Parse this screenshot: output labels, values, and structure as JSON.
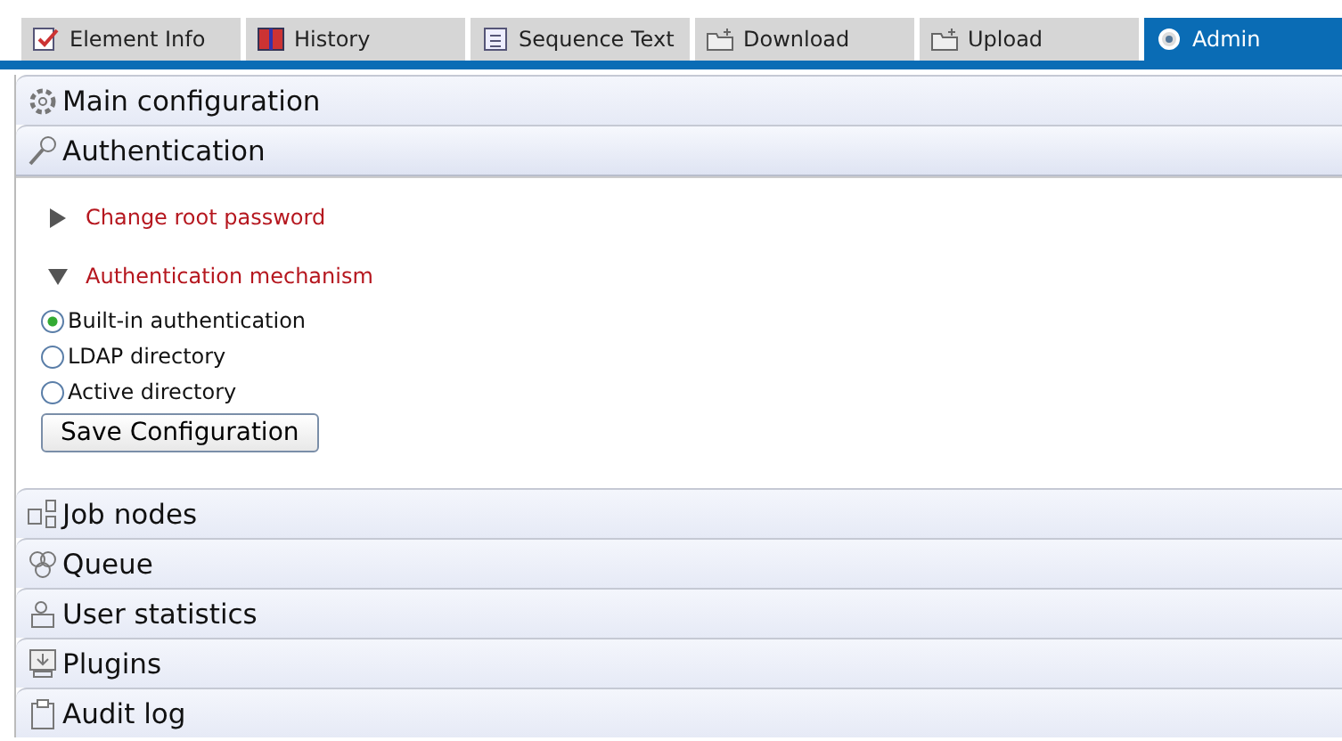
{
  "tabs": [
    {
      "label": "Element Info",
      "selected": false
    },
    {
      "label": "History",
      "selected": false
    },
    {
      "label": "Sequence Text",
      "selected": false
    },
    {
      "label": "Download",
      "selected": false
    },
    {
      "label": "Upload",
      "selected": false
    },
    {
      "label": "Admin",
      "selected": true
    }
  ],
  "sections": [
    {
      "title": "Main configuration",
      "expanded": false
    },
    {
      "title": "Authentication",
      "expanded": true,
      "subsections": [
        {
          "title": "Change root password",
          "expanded": false
        },
        {
          "title": "Authentication mechanism",
          "expanded": true,
          "options": [
            {
              "label": "Built-in authentication",
              "selected": true
            },
            {
              "label": "LDAP directory",
              "selected": false
            },
            {
              "label": "Active directory",
              "selected": false
            }
          ],
          "button": "Save Configuration"
        }
      ]
    },
    {
      "title": "Job nodes",
      "expanded": false
    },
    {
      "title": "Queue",
      "expanded": false
    },
    {
      "title": "User statistics",
      "expanded": false
    },
    {
      "title": "Plugins",
      "expanded": false
    },
    {
      "title": "Audit log",
      "expanded": false
    }
  ]
}
